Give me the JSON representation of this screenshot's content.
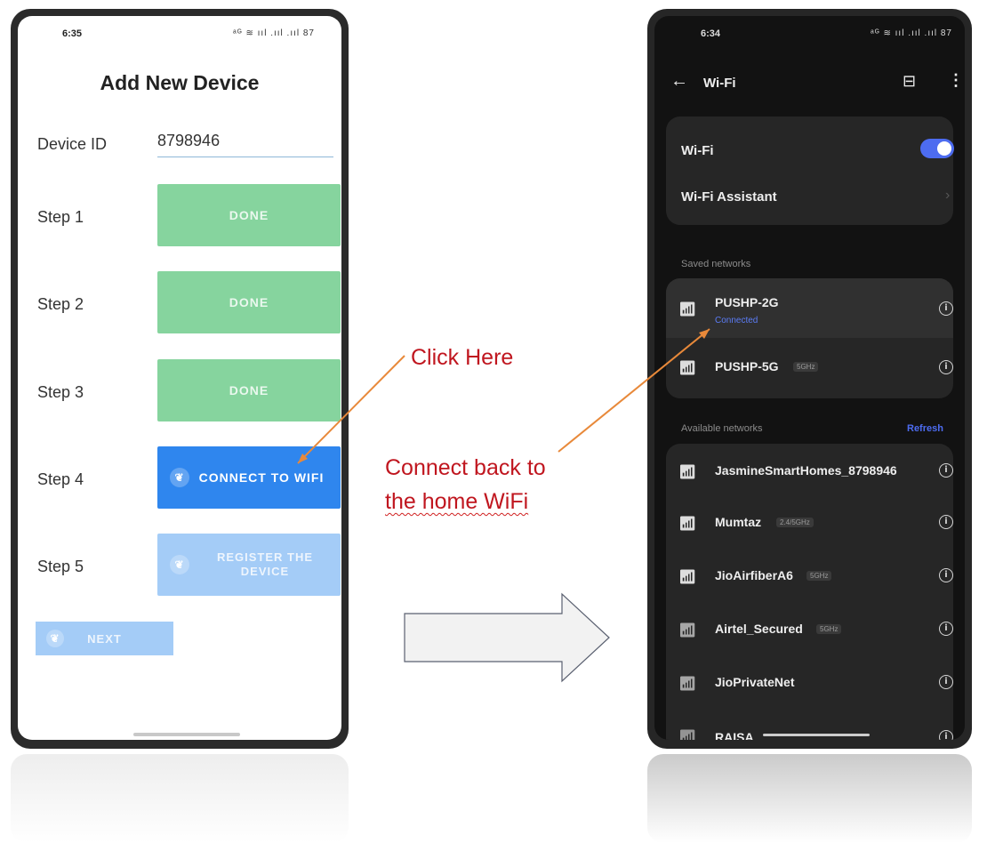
{
  "left_phone": {
    "status_time": "6:35",
    "status_icons": "ᵃᴳ ≋ ııl .ııl .ııl 87",
    "title": "Add New Device",
    "device_id_label": "Device ID",
    "device_id_value": "8798946",
    "steps": [
      {
        "label": "Step 1",
        "button": "DONE"
      },
      {
        "label": "Step 2",
        "button": "DONE"
      },
      {
        "label": "Step 3",
        "button": "DONE"
      },
      {
        "label": "Step 4",
        "button": "CONNECT TO WIFI"
      },
      {
        "label": "Step 5",
        "button": "REGISTER THE DEVICE"
      }
    ],
    "next_button": "NEXT",
    "accent_colors": {
      "done": "#86d49e",
      "primary": "#2f86ee",
      "disabled": "#a4ccf7"
    }
  },
  "right_phone": {
    "status_time": "6:34",
    "status_icons": "ᵃᴳ ≋ ııl .ııl .ııl 87",
    "header_title": "Wi-Fi",
    "wifi_toggle_label": "Wi-Fi",
    "wifi_assistant_label": "Wi-Fi Assistant",
    "saved_networks_label": "Saved networks",
    "saved_networks": [
      {
        "name": "PUSHP-2G",
        "status": "Connected"
      },
      {
        "name": "PUSHP-5G",
        "tag": "5GHz"
      }
    ],
    "available_networks_label": "Available networks",
    "refresh_label": "Refresh",
    "available_networks": [
      {
        "name": "JasmineSmartHomes_8798946"
      },
      {
        "name": "Mumtaz",
        "tag": "2.4/5GHz"
      },
      {
        "name": "JioAirfiberA6",
        "tag": "5GHz"
      },
      {
        "name": "Airtel_Secured",
        "tag": "5GHz"
      },
      {
        "name": "JioPrivateNet"
      },
      {
        "name": "RAISA"
      }
    ],
    "accent_color": "#4d6cf0"
  },
  "annotations": {
    "click_here": "Click Here",
    "connect_back_line1": "Connect back to",
    "connect_back_line2": "the home WiFi"
  }
}
